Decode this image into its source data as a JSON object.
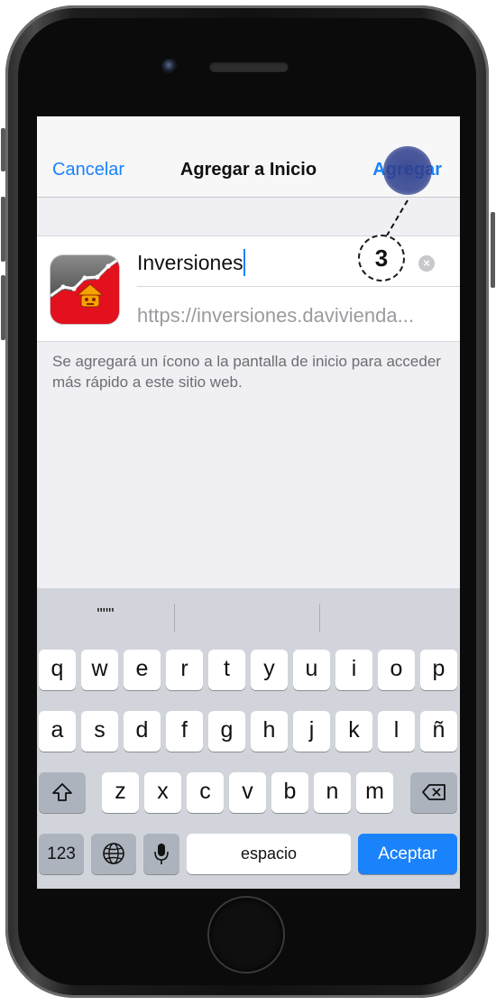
{
  "navbar": {
    "cancel_label": "Cancelar",
    "title": "Agregar a Inicio",
    "add_label": "Agregar"
  },
  "form": {
    "name_value": "Inversiones",
    "url": "https://inversiones.davivienda...",
    "step_number": "3"
  },
  "hint_text": "Se agregará un ícono a la pantalla de inicio para acceder más rápido a este sitio web.",
  "keyboard": {
    "suggestions": [
      "\"\"\"",
      "",
      ""
    ],
    "row1": [
      "q",
      "w",
      "e",
      "r",
      "t",
      "y",
      "u",
      "i",
      "o",
      "p"
    ],
    "row2": [
      "a",
      "s",
      "d",
      "f",
      "g",
      "h",
      "j",
      "k",
      "l",
      "ñ"
    ],
    "row3": [
      "z",
      "x",
      "c",
      "v",
      "b",
      "n",
      "m"
    ],
    "numbers_label": "123",
    "space_label": "espacio",
    "accept_label": "Aceptar"
  },
  "colors": {
    "accent": "#1a82fb",
    "touch_indicator": "#2d3e8c",
    "app_icon_red": "#e3101e"
  }
}
